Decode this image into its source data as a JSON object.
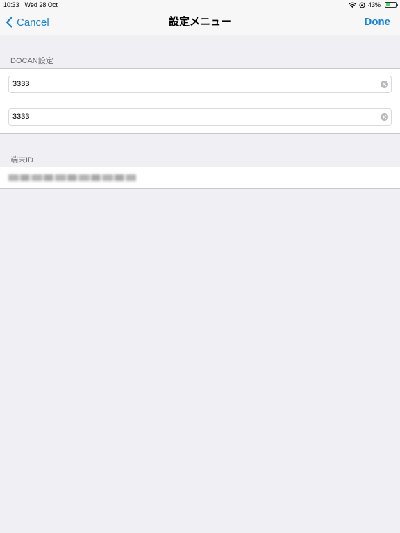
{
  "status": {
    "time": "10:33",
    "date": "Wed 28 Oct",
    "battery": "43%",
    "battery_level": 0.43
  },
  "nav": {
    "back_label": "Cancel",
    "title": "設定メニュー",
    "done_label": "Done"
  },
  "docan_section": {
    "header": "DOCAN設定",
    "field1_value": "3333",
    "field2_value": "3333"
  },
  "device_section": {
    "header": "端末ID",
    "device_id": "••••••••••••••••••••••••••"
  },
  "colors": {
    "accent": "#1a82d6",
    "background": "#efeff4"
  },
  "icons": [
    "chevron-left-icon",
    "wifi-icon",
    "rotation-lock-icon",
    "battery-icon",
    "clear-icon"
  ]
}
